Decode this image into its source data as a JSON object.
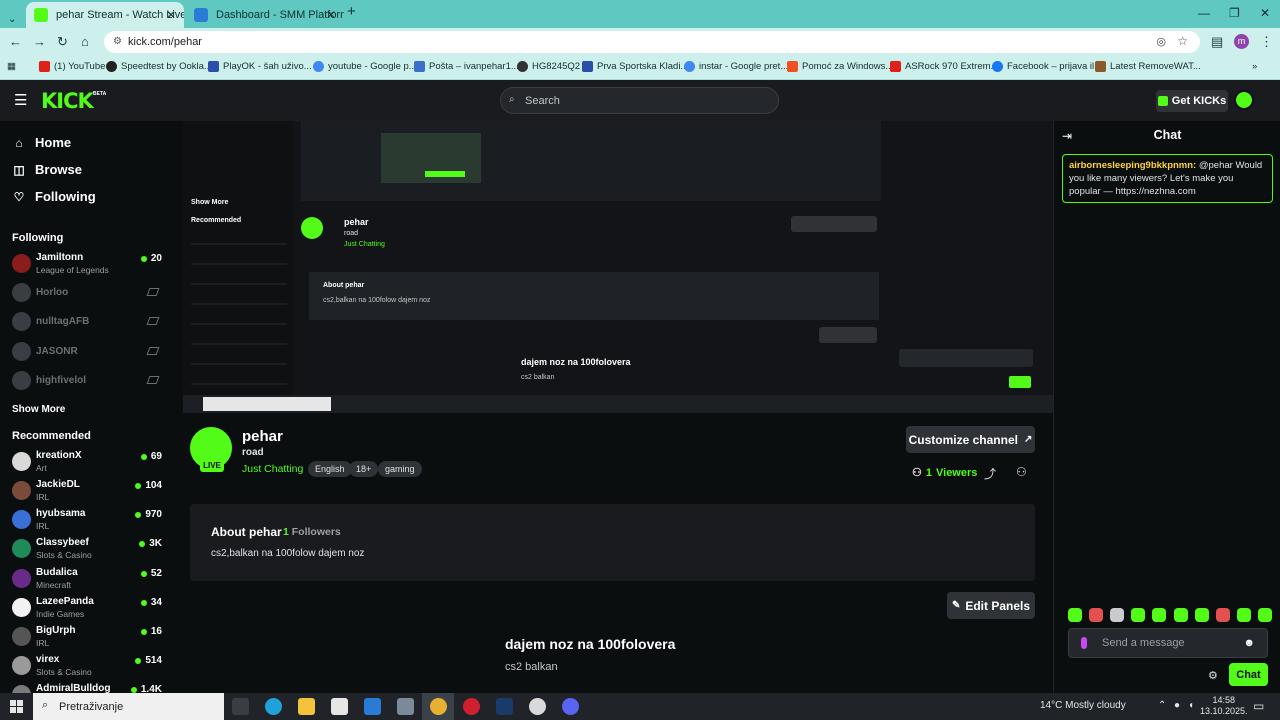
{
  "browser": {
    "tabs": [
      {
        "label": "pehar Stream - Watch Live on Kick",
        "active": true
      },
      {
        "label": "Dashboard - SMM Platform",
        "active": false
      }
    ],
    "url": "kick.com/pehar",
    "bookmarks": [
      "(1) YouTube",
      "Speedtest by Ookla...",
      "PlayOK - šah uživo...",
      "youtube - Google p...",
      "Pošta – ivanpehar1...",
      "HG8245Q2",
      "Prva Sportska Kladi...",
      "instar - Google pret...",
      "Pomoć za Windows...",
      "ASRock 970 Extrem...",
      "Facebook – prijava il...",
      "Latest RemoveWAT..."
    ]
  },
  "header": {
    "logo": "KICK",
    "beta": "BETA",
    "search_placeholder": "Search",
    "get_kicks": "Get KICKs"
  },
  "sidebar": {
    "nav": [
      "Home",
      "Browse",
      "Following"
    ],
    "following_heading": "Following",
    "following": [
      {
        "name": "Jamiltonn",
        "category": "League of Legends",
        "viewers": "20",
        "live": true
      },
      {
        "name": "Horloo",
        "live": false
      },
      {
        "name": "nulltagAFB",
        "live": false
      },
      {
        "name": "JASONR",
        "live": false
      },
      {
        "name": "highfivelol",
        "live": false
      }
    ],
    "show_more": "Show More",
    "recommended_heading": "Recommended",
    "recommended": [
      {
        "name": "kreationX",
        "category": "Art",
        "viewers": "69"
      },
      {
        "name": "JackieDL",
        "category": "IRL",
        "viewers": "104"
      },
      {
        "name": "hyubsama",
        "category": "IRL",
        "viewers": "970"
      },
      {
        "name": "Classybeef",
        "category": "Slots & Casino",
        "viewers": "3K"
      },
      {
        "name": "Budalica",
        "category": "Minecraft",
        "viewers": "52"
      },
      {
        "name": "LazeePanda",
        "category": "Indie Games",
        "viewers": "34"
      },
      {
        "name": "BigUrph",
        "category": "IRL",
        "viewers": "16"
      },
      {
        "name": "virex",
        "category": "Slots & Casino",
        "viewers": "514"
      },
      {
        "name": "AdmiralBulldog",
        "category": "",
        "viewers": "1.4K"
      }
    ]
  },
  "stream": {
    "streamer": "pehar",
    "live_badge": "LIVE",
    "title": "road",
    "category": "Just Chatting",
    "tags": [
      "English",
      "18+",
      "gaming"
    ],
    "customize": "Customize channel",
    "viewers_count": "1",
    "viewers_label": "Viewers"
  },
  "about": {
    "heading": "About pehar",
    "followers_count": "1",
    "followers_label": "Followers",
    "description": "cs2,balkan na 100folow dajem noz"
  },
  "panels": {
    "edit": "Edit Panels",
    "title": "dajem noz na 100folovera",
    "desc": "cs2 balkan"
  },
  "chat": {
    "title": "Chat",
    "pinned_user": "airbornesleeping9bkkpnmn:",
    "pinned_text": "@pehar Would you like many viewers? Let's make you popular — https://nezhna.com",
    "placeholder": "Send a message",
    "send": "Chat"
  },
  "taskbar": {
    "search": "Pretraživanje",
    "weather": "14°C  Mostly cloudy",
    "time": "14:58",
    "date": "13.10.2025."
  },
  "colors": {
    "accent": "#53fc18",
    "bg": "#0b0e0f",
    "panel": "#191b1f"
  }
}
